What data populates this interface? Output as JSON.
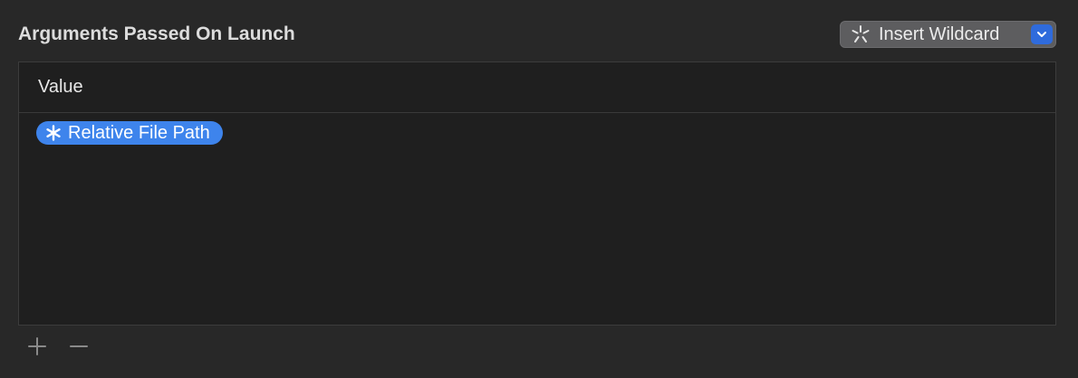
{
  "section": {
    "title": "Arguments Passed On Launch"
  },
  "insert_wildcard": {
    "label": "Insert Wildcard",
    "icon": "wildcard-sparkle-icon",
    "chevron_icon": "chevron-down-icon",
    "accent_color": "#2f6bdc"
  },
  "table": {
    "columns": [
      "Value"
    ],
    "rows": [
      {
        "token_label": "Relative File Path",
        "token_icon": "asterisk-icon",
        "token_color": "#3e84ec"
      }
    ]
  },
  "controls": {
    "add_icon": "plus-icon",
    "remove_icon": "minus-icon"
  }
}
